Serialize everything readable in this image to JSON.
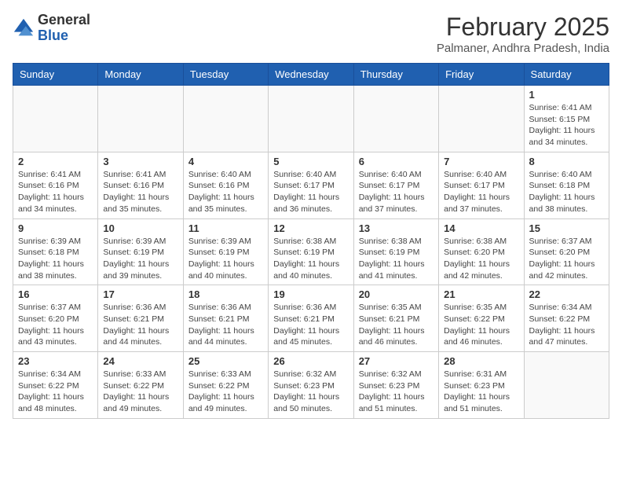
{
  "header": {
    "logo_general": "General",
    "logo_blue": "Blue",
    "month_year": "February 2025",
    "location": "Palmaner, Andhra Pradesh, India"
  },
  "weekdays": [
    "Sunday",
    "Monday",
    "Tuesday",
    "Wednesday",
    "Thursday",
    "Friday",
    "Saturday"
  ],
  "weeks": [
    [
      {
        "day": "",
        "info": ""
      },
      {
        "day": "",
        "info": ""
      },
      {
        "day": "",
        "info": ""
      },
      {
        "day": "",
        "info": ""
      },
      {
        "day": "",
        "info": ""
      },
      {
        "day": "",
        "info": ""
      },
      {
        "day": "1",
        "info": "Sunrise: 6:41 AM\nSunset: 6:15 PM\nDaylight: 11 hours\nand 34 minutes."
      }
    ],
    [
      {
        "day": "2",
        "info": "Sunrise: 6:41 AM\nSunset: 6:16 PM\nDaylight: 11 hours\nand 34 minutes."
      },
      {
        "day": "3",
        "info": "Sunrise: 6:41 AM\nSunset: 6:16 PM\nDaylight: 11 hours\nand 35 minutes."
      },
      {
        "day": "4",
        "info": "Sunrise: 6:40 AM\nSunset: 6:16 PM\nDaylight: 11 hours\nand 35 minutes."
      },
      {
        "day": "5",
        "info": "Sunrise: 6:40 AM\nSunset: 6:17 PM\nDaylight: 11 hours\nand 36 minutes."
      },
      {
        "day": "6",
        "info": "Sunrise: 6:40 AM\nSunset: 6:17 PM\nDaylight: 11 hours\nand 37 minutes."
      },
      {
        "day": "7",
        "info": "Sunrise: 6:40 AM\nSunset: 6:17 PM\nDaylight: 11 hours\nand 37 minutes."
      },
      {
        "day": "8",
        "info": "Sunrise: 6:40 AM\nSunset: 6:18 PM\nDaylight: 11 hours\nand 38 minutes."
      }
    ],
    [
      {
        "day": "9",
        "info": "Sunrise: 6:39 AM\nSunset: 6:18 PM\nDaylight: 11 hours\nand 38 minutes."
      },
      {
        "day": "10",
        "info": "Sunrise: 6:39 AM\nSunset: 6:19 PM\nDaylight: 11 hours\nand 39 minutes."
      },
      {
        "day": "11",
        "info": "Sunrise: 6:39 AM\nSunset: 6:19 PM\nDaylight: 11 hours\nand 40 minutes."
      },
      {
        "day": "12",
        "info": "Sunrise: 6:38 AM\nSunset: 6:19 PM\nDaylight: 11 hours\nand 40 minutes."
      },
      {
        "day": "13",
        "info": "Sunrise: 6:38 AM\nSunset: 6:19 PM\nDaylight: 11 hours\nand 41 minutes."
      },
      {
        "day": "14",
        "info": "Sunrise: 6:38 AM\nSunset: 6:20 PM\nDaylight: 11 hours\nand 42 minutes."
      },
      {
        "day": "15",
        "info": "Sunrise: 6:37 AM\nSunset: 6:20 PM\nDaylight: 11 hours\nand 42 minutes."
      }
    ],
    [
      {
        "day": "16",
        "info": "Sunrise: 6:37 AM\nSunset: 6:20 PM\nDaylight: 11 hours\nand 43 minutes."
      },
      {
        "day": "17",
        "info": "Sunrise: 6:36 AM\nSunset: 6:21 PM\nDaylight: 11 hours\nand 44 minutes."
      },
      {
        "day": "18",
        "info": "Sunrise: 6:36 AM\nSunset: 6:21 PM\nDaylight: 11 hours\nand 44 minutes."
      },
      {
        "day": "19",
        "info": "Sunrise: 6:36 AM\nSunset: 6:21 PM\nDaylight: 11 hours\nand 45 minutes."
      },
      {
        "day": "20",
        "info": "Sunrise: 6:35 AM\nSunset: 6:21 PM\nDaylight: 11 hours\nand 46 minutes."
      },
      {
        "day": "21",
        "info": "Sunrise: 6:35 AM\nSunset: 6:22 PM\nDaylight: 11 hours\nand 46 minutes."
      },
      {
        "day": "22",
        "info": "Sunrise: 6:34 AM\nSunset: 6:22 PM\nDaylight: 11 hours\nand 47 minutes."
      }
    ],
    [
      {
        "day": "23",
        "info": "Sunrise: 6:34 AM\nSunset: 6:22 PM\nDaylight: 11 hours\nand 48 minutes."
      },
      {
        "day": "24",
        "info": "Sunrise: 6:33 AM\nSunset: 6:22 PM\nDaylight: 11 hours\nand 49 minutes."
      },
      {
        "day": "25",
        "info": "Sunrise: 6:33 AM\nSunset: 6:22 PM\nDaylight: 11 hours\nand 49 minutes."
      },
      {
        "day": "26",
        "info": "Sunrise: 6:32 AM\nSunset: 6:23 PM\nDaylight: 11 hours\nand 50 minutes."
      },
      {
        "day": "27",
        "info": "Sunrise: 6:32 AM\nSunset: 6:23 PM\nDaylight: 11 hours\nand 51 minutes."
      },
      {
        "day": "28",
        "info": "Sunrise: 6:31 AM\nSunset: 6:23 PM\nDaylight: 11 hours\nand 51 minutes."
      },
      {
        "day": "",
        "info": ""
      }
    ]
  ]
}
